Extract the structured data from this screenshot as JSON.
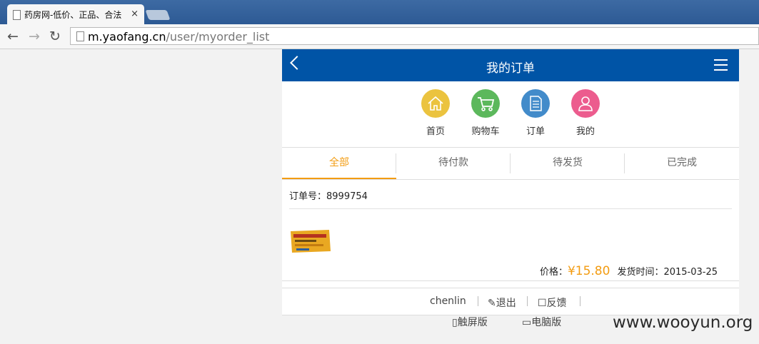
{
  "browser": {
    "tab_title": "药房网-低价、正品、合法",
    "tab_close": "×",
    "url_host": "m.yaofang.cn",
    "url_path": "/user/myorder_list",
    "back_glyph": "←",
    "forward_glyph": "→",
    "reload_glyph": "↻"
  },
  "header": {
    "title": "我的订单"
  },
  "quicknav": [
    {
      "label": "首页",
      "icon": "home-icon",
      "color": "#ebc33f"
    },
    {
      "label": "购物车",
      "icon": "cart-icon",
      "color": "#5cb85c"
    },
    {
      "label": "订单",
      "icon": "document-icon",
      "color": "#428bca"
    },
    {
      "label": "我的",
      "icon": "user-icon",
      "color": "#ec5c8e"
    }
  ],
  "tabs": [
    {
      "label": "全部",
      "active": true
    },
    {
      "label": "待付款",
      "active": false
    },
    {
      "label": "待发货",
      "active": false
    },
    {
      "label": "已完成",
      "active": false
    }
  ],
  "order": {
    "number_label": "订单号：8999754",
    "price_label": "价格：",
    "price": "¥15.80",
    "ship_label": "发货时间：2015-03-25"
  },
  "footer": {
    "username": "chenlin",
    "logout": "退出",
    "feedback": "反馈"
  },
  "versions": {
    "touch": "触屏版",
    "pc": "电脑版"
  },
  "watermark": "www.wooyun.org",
  "colors": {
    "accent": "#f39c12",
    "header": "#0054a6"
  }
}
